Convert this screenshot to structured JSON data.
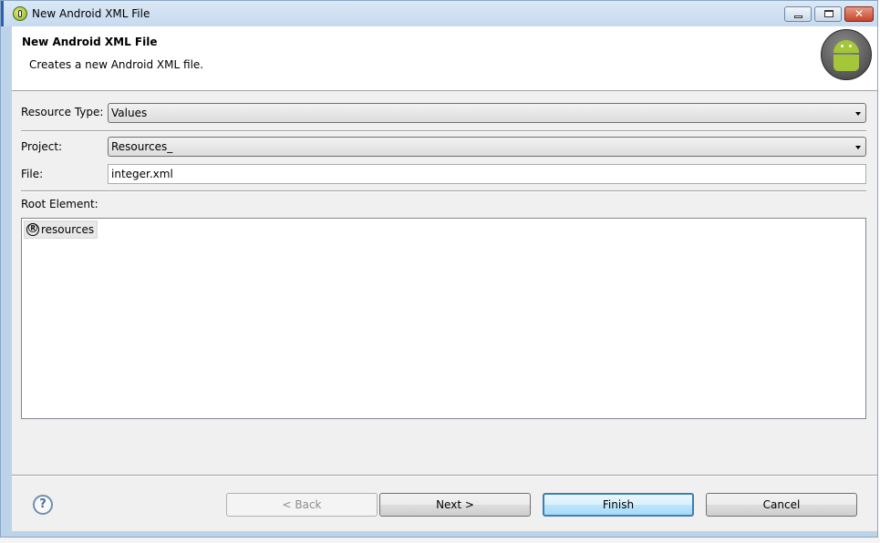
{
  "window": {
    "title": "New Android XML File"
  },
  "header": {
    "title": "New Android XML File",
    "description": "Creates a new Android XML file."
  },
  "form": {
    "resource_type_label": "Resource Type:",
    "resource_type_value": "Values",
    "project_label": "Project:",
    "project_value": "Resources_",
    "file_label": "File:",
    "file_value": "integer.xml",
    "root_element_label": "Root Element:",
    "root_elements": [
      {
        "icon": "Ⓡ",
        "label": "resources"
      }
    ]
  },
  "buttons": {
    "back": "< Back",
    "next": "Next >",
    "finish": "Finish",
    "cancel": "Cancel",
    "help": "?"
  },
  "window_controls": {
    "close": "✕"
  },
  "colors": {
    "accent": "#3c7fb1",
    "android_green": "#a4c639"
  },
  "icons": {
    "app": "eclipse-adt-icon",
    "banner": "android-robot-icon",
    "help": "help-icon",
    "root_item": "resource-icon"
  }
}
